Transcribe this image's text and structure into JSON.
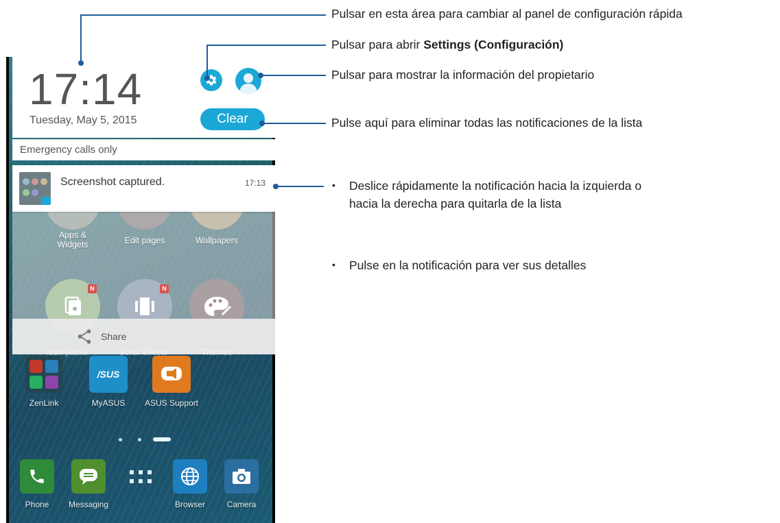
{
  "shade": {
    "time": "17:14",
    "date": "Tuesday, May 5, 2015",
    "clear_label": "Clear",
    "emergency": "Emergency calls only"
  },
  "notification": {
    "title": "Screenshot captured.",
    "time": "17:13"
  },
  "panel": {
    "items_row1": [
      "Apps &\nWidgets",
      "Edit pages",
      "Wallpapers"
    ],
    "items_row2": [
      "Icon packs",
      "Scroll effects",
      "Themes"
    ],
    "badge": "N",
    "share_label": "Share"
  },
  "home": {
    "apps_row": [
      "ZenLink",
      "MyASUS",
      "ASUS Support"
    ],
    "asus_logo": "/SUS",
    "dock": [
      "Phone",
      "Messaging",
      "Browser",
      "Camera"
    ]
  },
  "callouts": {
    "quick_settings": "Pulsar en esta área para cambiar al panel de configuración rápida",
    "settings_prefix": "Pulsar para abrir ",
    "settings_bold": "Settings (Configuración)",
    "owner": "Pulsar para mostrar la información del propietario",
    "clear": "Pulse aquí para eliminar todas las notificaciones de la lista",
    "bullet1": "Deslice rápidamente la notificación hacia la izquierda o hacia la derecha para quitarla de la lista",
    "bullet2": "Pulse en la notificación para ver sus detalles",
    "bullet_char": "•"
  },
  "colors": {
    "accent": "#1ba8d6",
    "callout": "#1f5c9c"
  }
}
